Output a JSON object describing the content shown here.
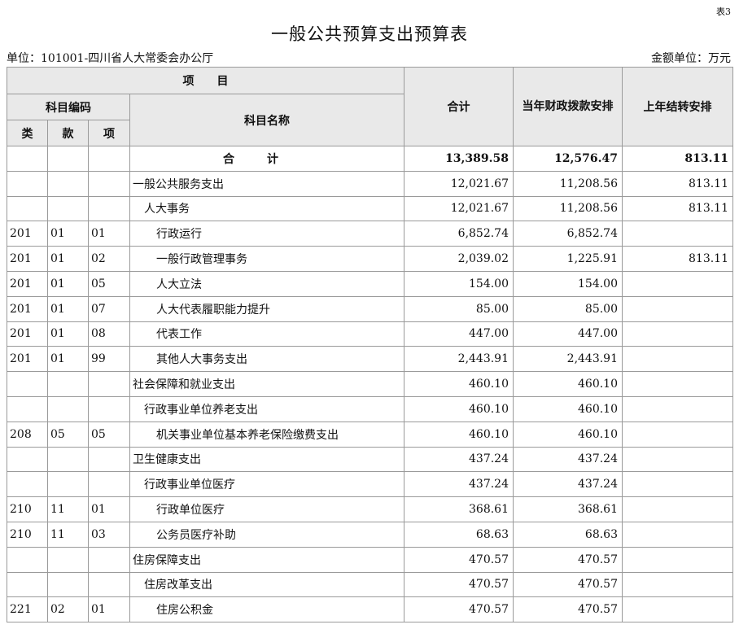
{
  "doc": {
    "table_no": "表3",
    "title": "一般公共预算支出预算表",
    "unit_left": "单位：101001-四川省人大常委会办公厅",
    "unit_right": "金额单位：万元"
  },
  "headers": {
    "project": "项　　目",
    "code": "科目编码",
    "lei": "类",
    "kuan": "款",
    "xiang": "项",
    "name": "科目名称",
    "total": "合计",
    "current": "当年财政拨款安排",
    "carryover": "上年结转安排"
  },
  "total_row": {
    "label": "合计",
    "total": "13,389.58",
    "current": "12,576.47",
    "carryover": "813.11"
  },
  "rows": [
    {
      "lei": "",
      "kuan": "",
      "xiang": "",
      "name": "一般公共服务支出",
      "total": "12,021.67",
      "current": "11,208.56",
      "carryover": "813.11"
    },
    {
      "lei": "",
      "kuan": "",
      "xiang": "",
      "name": "人大事务",
      "total": "12,021.67",
      "current": "11,208.56",
      "carryover": "813.11"
    },
    {
      "lei": "201",
      "kuan": "01",
      "xiang": "01",
      "name": "行政运行",
      "total": "6,852.74",
      "current": "6,852.74",
      "carryover": ""
    },
    {
      "lei": "201",
      "kuan": "01",
      "xiang": "02",
      "name": "一般行政管理事务",
      "total": "2,039.02",
      "current": "1,225.91",
      "carryover": "813.11"
    },
    {
      "lei": "201",
      "kuan": "01",
      "xiang": "05",
      "name": "人大立法",
      "total": "154.00",
      "current": "154.00",
      "carryover": ""
    },
    {
      "lei": "201",
      "kuan": "01",
      "xiang": "07",
      "name": "人大代表履职能力提升",
      "total": "85.00",
      "current": "85.00",
      "carryover": ""
    },
    {
      "lei": "201",
      "kuan": "01",
      "xiang": "08",
      "name": "代表工作",
      "total": "447.00",
      "current": "447.00",
      "carryover": ""
    },
    {
      "lei": "201",
      "kuan": "01",
      "xiang": "99",
      "name": "其他人大事务支出",
      "total": "2,443.91",
      "current": "2,443.91",
      "carryover": ""
    },
    {
      "lei": "",
      "kuan": "",
      "xiang": "",
      "name": "社会保障和就业支出",
      "total": "460.10",
      "current": "460.10",
      "carryover": ""
    },
    {
      "lei": "",
      "kuan": "",
      "xiang": "",
      "name": "行政事业单位养老支出",
      "total": "460.10",
      "current": "460.10",
      "carryover": ""
    },
    {
      "lei": "208",
      "kuan": "05",
      "xiang": "05",
      "name": "机关事业单位基本养老保险缴费支出",
      "total": "460.10",
      "current": "460.10",
      "carryover": ""
    },
    {
      "lei": "",
      "kuan": "",
      "xiang": "",
      "name": "卫生健康支出",
      "total": "437.24",
      "current": "437.24",
      "carryover": ""
    },
    {
      "lei": "",
      "kuan": "",
      "xiang": "",
      "name": "行政事业单位医疗",
      "total": "437.24",
      "current": "437.24",
      "carryover": ""
    },
    {
      "lei": "210",
      "kuan": "11",
      "xiang": "01",
      "name": "行政单位医疗",
      "total": "368.61",
      "current": "368.61",
      "carryover": ""
    },
    {
      "lei": "210",
      "kuan": "11",
      "xiang": "03",
      "name": "公务员医疗补助",
      "total": "68.63",
      "current": "68.63",
      "carryover": ""
    },
    {
      "lei": "",
      "kuan": "",
      "xiang": "",
      "name": "住房保障支出",
      "total": "470.57",
      "current": "470.57",
      "carryover": ""
    },
    {
      "lei": "",
      "kuan": "",
      "xiang": "",
      "name": "住房改革支出",
      "total": "470.57",
      "current": "470.57",
      "carryover": ""
    },
    {
      "lei": "221",
      "kuan": "02",
      "xiang": "01",
      "name": "住房公积金",
      "total": "470.57",
      "current": "470.57",
      "carryover": ""
    }
  ]
}
